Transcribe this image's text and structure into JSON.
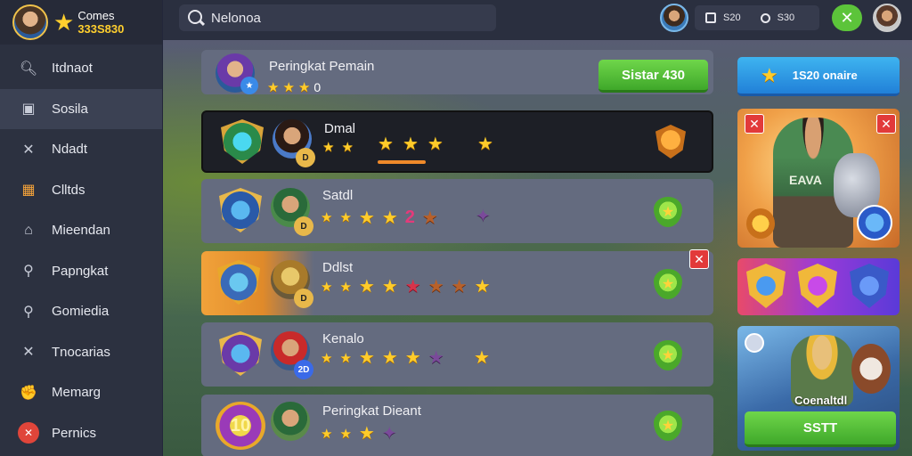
{
  "profile": {
    "name": "Comes",
    "score": "333S830"
  },
  "sidebar": {
    "items": [
      {
        "label": "Itdnaot",
        "icon": "search-icon"
      },
      {
        "label": "Sosila",
        "icon": "card-icon"
      },
      {
        "label": "Ndadt",
        "icon": "crossed-swords-icon"
      },
      {
        "label": "Clltds",
        "icon": "chest-icon"
      },
      {
        "label": "Mieendan",
        "icon": "home-icon"
      },
      {
        "label": "Papngkat",
        "icon": "search-icon"
      },
      {
        "label": "Gomiedia",
        "icon": "search-icon"
      },
      {
        "label": "Tnocarias",
        "icon": "crossed-swords-icon"
      },
      {
        "label": "Memarg",
        "icon": "gauntlet-icon"
      },
      {
        "label": "Pernics",
        "icon": "close-icon"
      }
    ]
  },
  "topbar": {
    "search_value": "Nelonoa",
    "stat_a": "S20",
    "stat_b": "S30"
  },
  "header": {
    "title": "Peringkat Pemain",
    "star_count": "0",
    "button_label": "Sistar 430"
  },
  "rows": [
    {
      "name": "Dmal",
      "rank": "D",
      "extra": ""
    },
    {
      "name": "Satdl",
      "rank": "D",
      "extra": "2"
    },
    {
      "name": "Ddlst",
      "rank": "D",
      "extra": ""
    },
    {
      "name": "Kenalo",
      "rank": "2D",
      "extra": ""
    },
    {
      "name": "Peringkat Dieant",
      "rank": "10",
      "extra": ""
    }
  ],
  "right": {
    "online_label": "1S20 onaire",
    "hero_label": "EAVA",
    "promo_title": "Coenaltdl",
    "promo_button": "SSTT"
  }
}
